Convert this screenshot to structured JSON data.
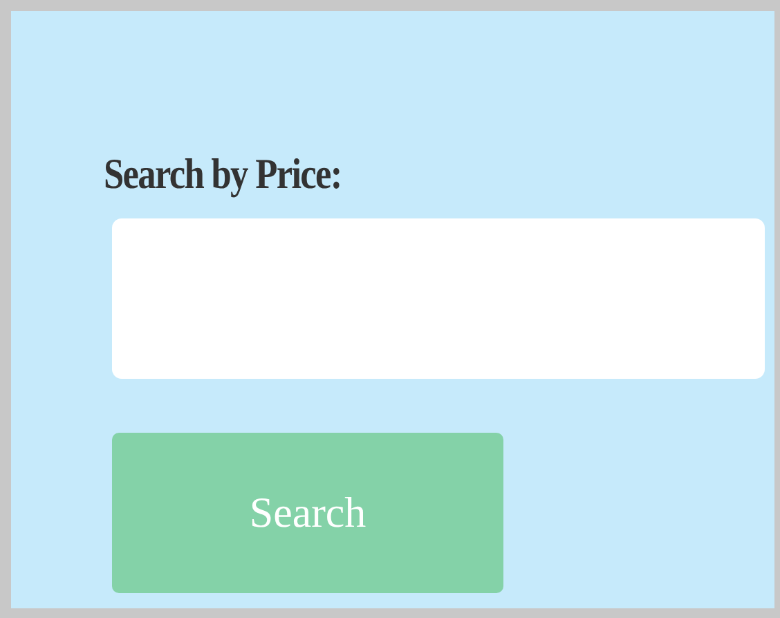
{
  "label": "Search by Price:",
  "button": "Search"
}
